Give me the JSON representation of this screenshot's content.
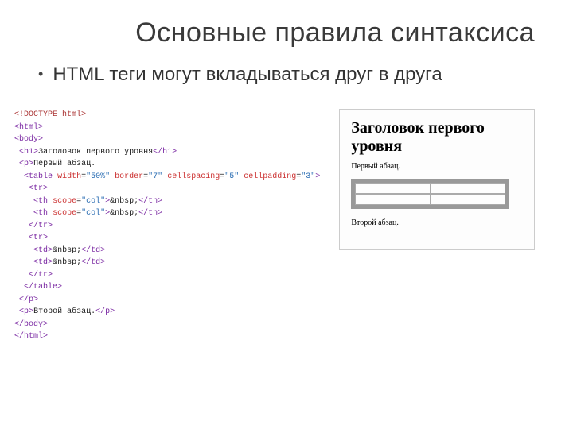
{
  "title": "Основные правила синтаксиса",
  "bullet": {
    "text": "HTML теги могут вкладываться друг в друга"
  },
  "code": {
    "l01_doctype": "<!DOCTYPE html>",
    "l02_html_open": "html",
    "l03_body_open": "body",
    "l04_h1_open": "h1",
    "l04_h1_text": "Заголовок первого уровня",
    "l04_h1_close": "h1",
    "l05_p_open": "p",
    "l05_p_text": "Первый абзац.",
    "l06_table": "table",
    "l06_a_width": "width",
    "l06_v_width": "\"50%\"",
    "l06_a_border": "border",
    "l06_v_border": "\"7\"",
    "l06_a_cspacing": "cellspacing",
    "l06_v_cspacing": "\"5\"",
    "l06_a_cpadding": "cellpadding",
    "l06_v_cpadding": "\"3\"",
    "l07_tr": "tr",
    "l08_th": "th",
    "l08_a_scope": "scope",
    "l08_v_scope": "\"col\"",
    "l08_text": "&nbsp;",
    "l11_td": "td",
    "l11_text": "&nbsp;",
    "l15_p2_text": "Второй абзац.",
    "l17_body_close": "body",
    "l18_html_close": "html"
  },
  "preview": {
    "heading": "Заголовок первого уровня",
    "p1": "Первый абзац.",
    "p2": "Второй абзац."
  }
}
